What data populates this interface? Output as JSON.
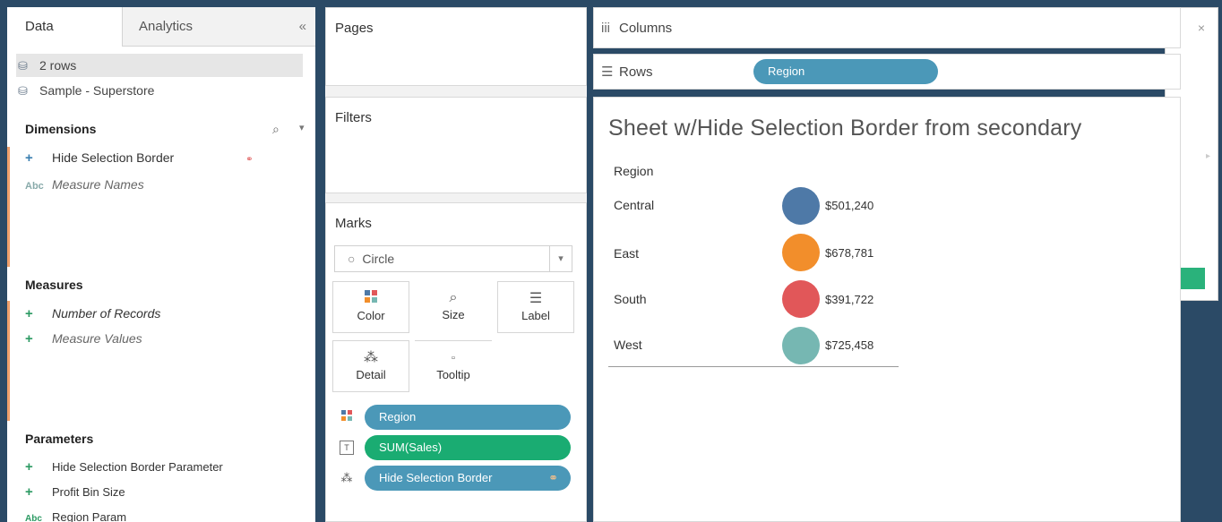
{
  "left_pane": {
    "tabs": {
      "data": "Data",
      "analytics": "Analytics",
      "collapse_glyph": "«"
    },
    "datasources": [
      {
        "label": "2 rows",
        "icon": "datasource-icon"
      },
      {
        "label": "Sample - Superstore",
        "icon": "datasource-icon"
      }
    ],
    "dimensions": {
      "header": "Dimensions",
      "search_glyph": "⌕",
      "menu_glyph": "▾",
      "items": [
        {
          "label": "Hide Selection Border",
          "icon_glyph": "+",
          "italic": false
        },
        {
          "label": "Measure Names",
          "icon_glyph": "Abc",
          "italic": true
        }
      ]
    },
    "measures": {
      "header": "Measures",
      "items": [
        {
          "label": "Number of Records",
          "icon_glyph": "+",
          "italic": true
        },
        {
          "label": "Measure Values",
          "icon_glyph": "+",
          "italic": true
        }
      ]
    },
    "parameters": {
      "header": "Parameters",
      "items": [
        {
          "label": "Hide Selection Border Parameter",
          "icon_glyph": "+"
        },
        {
          "label": "Profit Bin Size",
          "icon_glyph": "+"
        },
        {
          "label": "Region Param",
          "icon_glyph": "Abc"
        }
      ]
    }
  },
  "shelves": {
    "pages": "Pages",
    "filters": "Filters",
    "marks": {
      "title": "Marks",
      "mark_type": "Circle",
      "mark_type_glyph": "○",
      "buttons": {
        "color": "Color",
        "size": "Size",
        "label": "Label",
        "detail": "Detail",
        "tooltip": "Tooltip"
      },
      "pills": [
        {
          "label": "Region",
          "kind": "color"
        },
        {
          "label": "SUM(Sales)",
          "kind": "label"
        },
        {
          "label": "Hide Selection Border",
          "kind": "detail"
        }
      ]
    }
  },
  "columns_shelf": {
    "label": "Columns",
    "glyph": "iii"
  },
  "rows_shelf": {
    "label": "Rows",
    "glyph": "☰",
    "pill": "Region"
  },
  "view": {
    "title": "Sheet w/Hide Selection Border from secondary",
    "row_header": "Region",
    "rows": [
      {
        "region": "Central",
        "value": "$501,240",
        "color": "#4e79a7"
      },
      {
        "region": "East",
        "value": "$678,781",
        "color": "#f28e2b"
      },
      {
        "region": "South",
        "value": "$391,722",
        "color": "#e15759"
      },
      {
        "region": "West",
        "value": "$725,458",
        "color": "#76b7b2"
      }
    ]
  },
  "secondary_window": {
    "close_glyph": "×"
  },
  "colors": {
    "blue_pill": "#4b98b8",
    "green_pill": "#1aac72",
    "background": "#2b4a66"
  }
}
